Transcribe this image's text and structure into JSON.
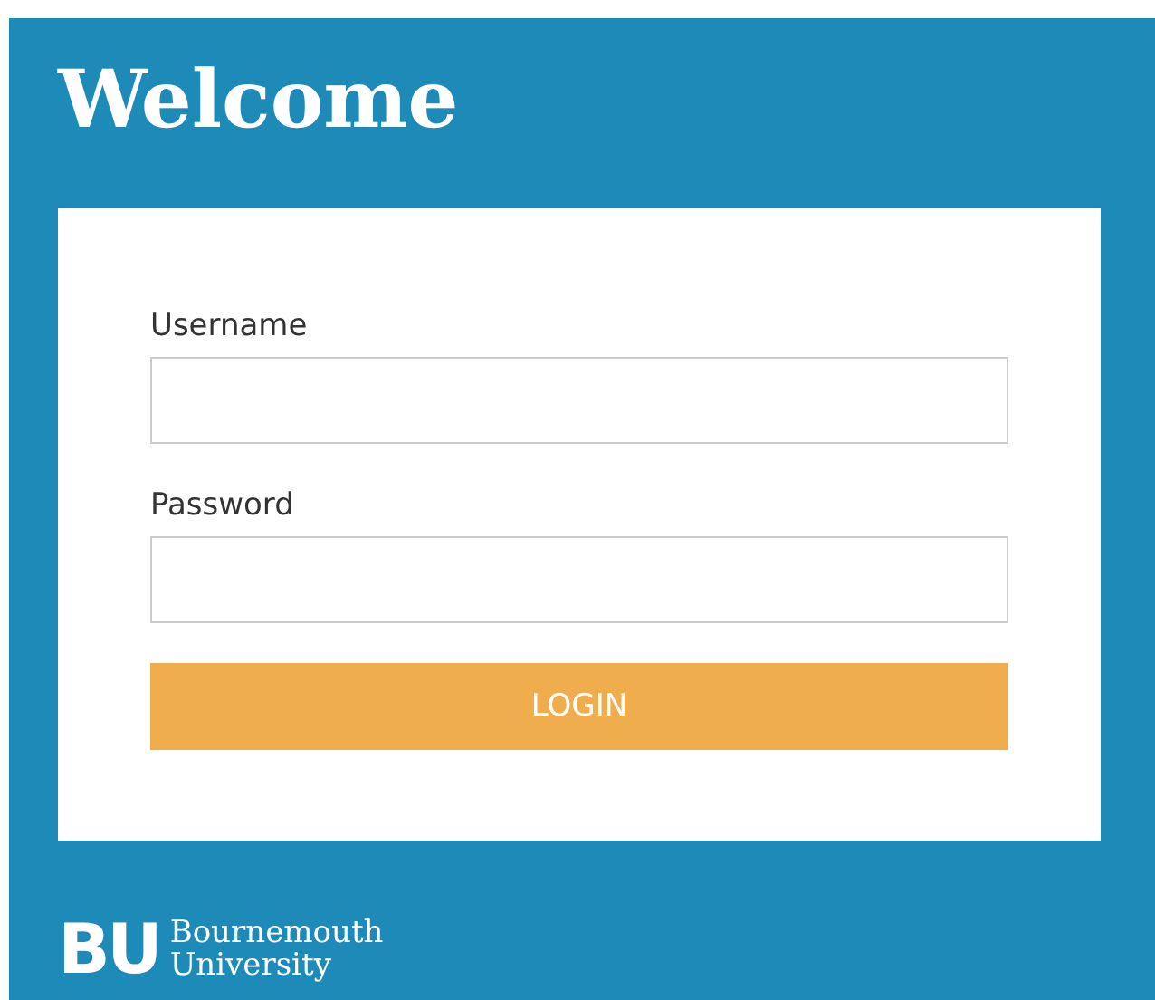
{
  "title": "Welcome",
  "fields": [
    {
      "label": "Username"
    },
    {
      "label": "Password"
    }
  ],
  "button": "LOGIN",
  "logo": {
    "mark": "BU",
    "lines": [
      "Bournemouth",
      "University"
    ]
  }
}
